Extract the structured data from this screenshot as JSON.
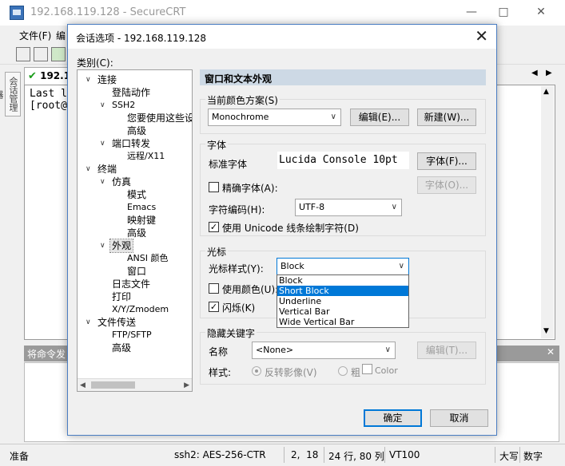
{
  "main_window": {
    "title": "192.168.119.128 - SecureCRT",
    "menu": [
      "文件(F)",
      "编"
    ],
    "tab_label": "192.1",
    "side_tab": "会话管理器",
    "terminal_lines": [
      "Last l",
      "[root@"
    ],
    "command_bar_label": "将命令发",
    "status": {
      "left": "准备",
      "encryption": "ssh2: AES-256-CTR",
      "cursor_pos": "2,  18",
      "size": "24 行, 80 列",
      "terminal_type": "VT100",
      "caps": "大写",
      "num": "数字"
    }
  },
  "dialog": {
    "title": "会话选项 - 192.168.119.128",
    "category_label": "类别(C):",
    "tree": [
      {
        "label": "连接",
        "expanded": true
      },
      {
        "label": "登陆动作"
      },
      {
        "label": "SSH2",
        "expanded": true
      },
      {
        "label": "您要使用这些设"
      },
      {
        "label": "高级"
      },
      {
        "label": "端口转发",
        "expanded": true
      },
      {
        "label": "远程/X11"
      },
      {
        "label": "终端",
        "expanded": true
      },
      {
        "label": "仿真",
        "expanded": true
      },
      {
        "label": "模式"
      },
      {
        "label": "Emacs"
      },
      {
        "label": "映射键"
      },
      {
        "label": "高级"
      },
      {
        "label": "外观",
        "expanded": true,
        "selected": true
      },
      {
        "label": "ANSI 颜色"
      },
      {
        "label": "窗口"
      },
      {
        "label": "日志文件"
      },
      {
        "label": "打印"
      },
      {
        "label": "X/Y/Zmodem"
      },
      {
        "label": "文件传送",
        "expanded": true
      },
      {
        "label": "FTP/SFTP"
      },
      {
        "label": "高级"
      }
    ],
    "panel_title": "窗口和文本外观",
    "color_scheme": {
      "group_label": "当前颜色方案(S)",
      "value": "Monochrome",
      "edit_button": "编辑(E)...",
      "new_button": "新建(W)..."
    },
    "font": {
      "group_label": "字体",
      "standard_label": "标准字体",
      "standard_value": "Lucida Console 10pt",
      "font_button": "字体(F)...",
      "precise_label": "精确字体(A):",
      "precise_checked": false,
      "precise_font_button": "字体(O)...",
      "encoding_label": "字符编码(H):",
      "encoding_value": "UTF-8",
      "unicode_label": "使用 Unicode 线条绘制字符(D)",
      "unicode_checked": true
    },
    "cursor": {
      "group_label": "光标",
      "style_label": "光标样式(Y):",
      "style_value": "Block",
      "use_color_label": "使用颜色(U):",
      "use_color_checked": false,
      "blink_label": "闪烁(K)",
      "blink_checked": true,
      "dropdown_options": [
        "Block",
        "Short Block",
        "Underline",
        "Vertical Bar",
        "Wide Vertical Bar"
      ],
      "highlighted_option": "Short Block"
    },
    "keywords": {
      "group_label": "隐藏关键字",
      "name_label": "名称",
      "name_value": "<None>",
      "edit_button": "编辑(T)...",
      "style_label": "样式:",
      "reverse_label": "反转影像(V)",
      "bold_label": "粗",
      "color_label": "Color"
    },
    "ok_button": "确定",
    "cancel_button": "取消"
  },
  "colors": {
    "accent": "#0078d7",
    "panel_header": "#cdd9e5",
    "tab_check": "#1a9d1a",
    "dialog_border": "#4a7dc2"
  }
}
